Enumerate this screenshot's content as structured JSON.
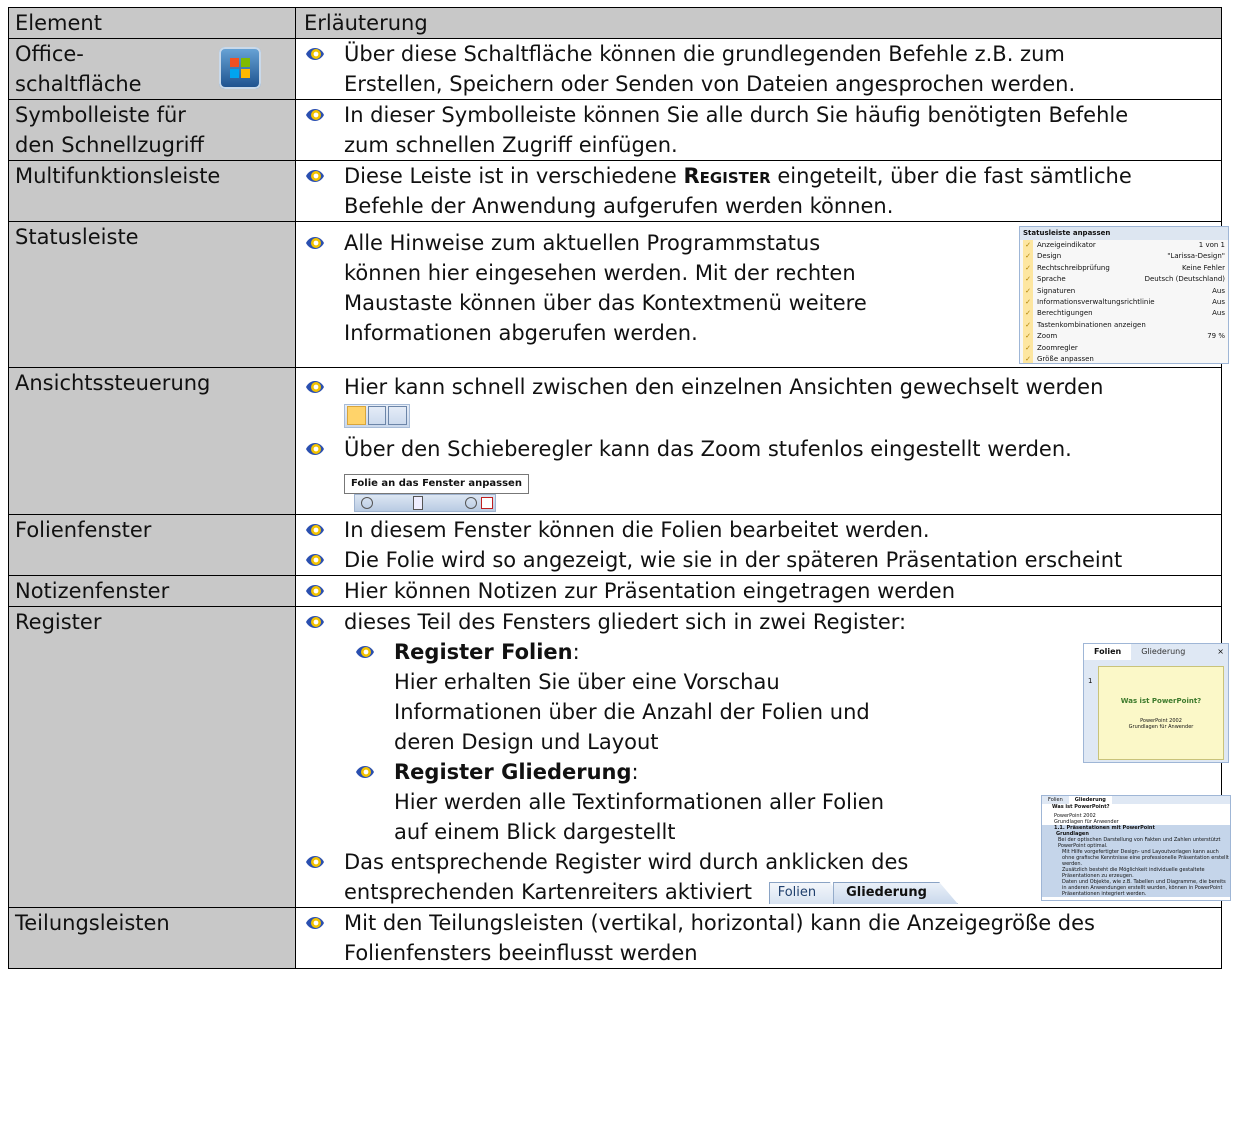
{
  "header": {
    "element": "Element",
    "erlaeuterung": "Erläuterung"
  },
  "rows": [
    {
      "name": "Office-\nschaltfläche",
      "lines": [
        "Über diese Schaltfläche können die grundlegenden Befehle z.B. zum",
        "Erstellen, Speichern oder Senden von Dateien angesprochen werden."
      ]
    },
    {
      "name_l1": "Symbolleiste für",
      "name_l2": "den Schnellzugriff",
      "lines": [
        "In dieser Symbolleiste können Sie alle durch Sie häufig benötigten Befehle",
        "zum schnellen Zugriff einfügen."
      ]
    },
    {
      "name": "Multifunktionsleiste",
      "line1_pre": "Diese Leiste ist in verschiedene ",
      "line1_bold": "Register",
      "line1_post": " eingeteilt, über die fast sämtliche",
      "line2": "Befehle der Anwendung aufgerufen werden können."
    },
    {
      "name": "Statusleiste",
      "lines": [
        "Alle Hinweise zum aktuellen Programmstatus",
        "können hier eingesehen werden. Mit der rechten",
        "Maustaste können über das Kontextmenü weitere",
        "Informationen abgerufen werden."
      ]
    },
    {
      "name": "Ansichtssteuerung",
      "line1": "Hier kann schnell zwischen den einzelnen Ansichten gewechselt werden",
      "line2": "Über den Schieberegler  kann das Zoom stufenlos eingestellt werden."
    },
    {
      "name": "Folienfenster",
      "lines": [
        "In diesem Fenster können die Folien bearbeitet werden.",
        "Die Folie wird so angezeigt, wie sie in der späteren Präsentation erscheint"
      ]
    },
    {
      "name": "Notizenfenster",
      "lines": [
        "Hier können Notizen zur Präsentation eingetragen werden"
      ]
    },
    {
      "name": "Register",
      "intro": "dieses Teil des Fensters gliedert sich in zwei Register:",
      "sub1_title": "Register Folien",
      "sub1_lines": [
        "Hier erhalten Sie über eine Vorschau",
        "Informationen über die Anzahl der Folien und",
        "deren Design und Layout"
      ],
      "sub2_title": "Register Gliederung",
      "sub2_lines": [
        "Hier werden alle Textinformationen aller Folien",
        "auf einem Blick dargestellt"
      ],
      "outro1": "Das entsprechende Register wird durch anklicken des",
      "outro2": "entsprechenden Kartenreiters aktiviert"
    },
    {
      "name": "Teilungsleisten",
      "lines": [
        "Mit den Teilungsleisten (vertikal, horizontal) kann die Anzeigegröße des",
        "Folienfensters beeinflusst werden"
      ]
    }
  ],
  "statusmenu": {
    "title": "Statusleiste anpassen",
    "items": [
      {
        "label": "Anzeigeindikator",
        "value": "1 von 1"
      },
      {
        "label": "Design",
        "value": "\"Larissa-Design\""
      },
      {
        "label": "Rechtschreibprüfung",
        "value": "Keine Fehler"
      },
      {
        "label": "Sprache",
        "value": "Deutsch (Deutschland)"
      },
      {
        "label": "Signaturen",
        "value": "Aus"
      },
      {
        "label": "Informationsverwaltungsrichtlinie",
        "value": "Aus"
      },
      {
        "label": "Berechtigungen",
        "value": "Aus"
      },
      {
        "label": "Tastenkombinationen anzeigen",
        "value": ""
      },
      {
        "label": "Zoom",
        "value": "79 %"
      },
      {
        "label": "Zoomregler",
        "value": ""
      },
      {
        "label": "Größe anpassen",
        "value": ""
      }
    ]
  },
  "zoomtip": "Folie an das Fenster anpassen",
  "foliepanel": {
    "tab1": "Folien",
    "tab2": "Gliederung",
    "close": "×",
    "slide_num": "1",
    "slide_title": "Was ist PowerPoint?",
    "slide_sub1": "PowerPoint 2002",
    "slide_sub2": "Grundlagen für Anwender"
  },
  "gliederpanel": {
    "tab1": "Folien",
    "tab2": "Gliederung",
    "l1": "Was ist PowerPoint?",
    "l2": "PowerPoint 2002",
    "l3": "Grundlagen für Anwender",
    "l4": "1.1. Präsentationen mit PowerPoint",
    "l5": "Grundlagen",
    "l6": "Bei der optischen Darstellung von Fakten und Zahlen unterstützt PowerPoint optimal.",
    "l7": "Mit Hilfe vorgefertigter Design- und Layoutvorlagen kann auch ohne grafische Kenntnisse eine professionelle Präsentation erstellt werden.",
    "l8": "Zusätzlich besteht die Möglichkeit individuelle gestaltete Präsentationen zu erzeugen.",
    "l9": "Daten und Objekte, wie z.B. Tabellen und Diagramme, die bereits in anderen Anwendungen erstellt wurden, können in PowerPoint Präsentationen integriert werden."
  },
  "tabs": {
    "folien": "Folien",
    "gliederung": "Gliederung"
  }
}
